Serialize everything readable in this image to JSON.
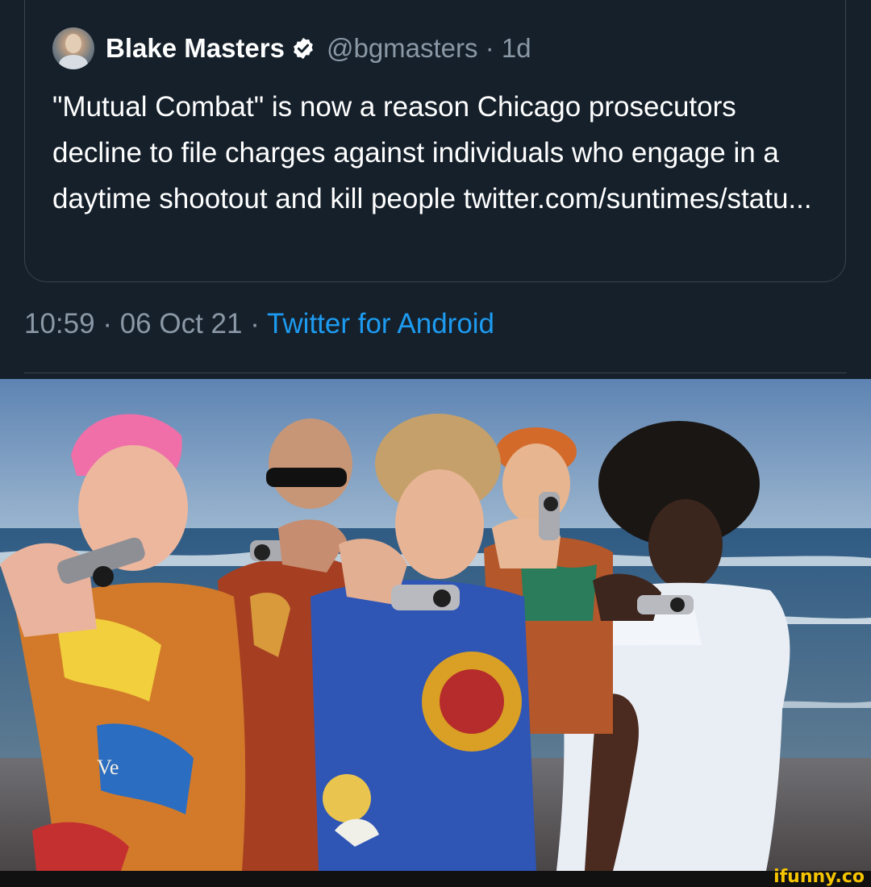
{
  "tweet": {
    "author_name": "Blake Masters",
    "handle": "@bgmasters",
    "separator": " · ",
    "age": "1d",
    "text": "\"Mutual Combat\" is now a reason Chicago prosecutors decline to file charges against individuals who engage in a daytime shootout and kill people twitter.com/suntimes/statu...",
    "time": "10:59",
    "date": "06 Oct 21",
    "source": "Twitter for Android",
    "icons": {
      "verified": "verified-badge-icon",
      "avatar": "avatar"
    }
  },
  "photo": {
    "description_visible": false,
    "shirt_text": "Ve"
  },
  "watermark": "ifunny.co",
  "colors": {
    "background": "#15202b",
    "border": "#38444d",
    "secondary_text": "#8b98a5",
    "link": "#1d9bf0",
    "watermark": "#f5c400"
  }
}
